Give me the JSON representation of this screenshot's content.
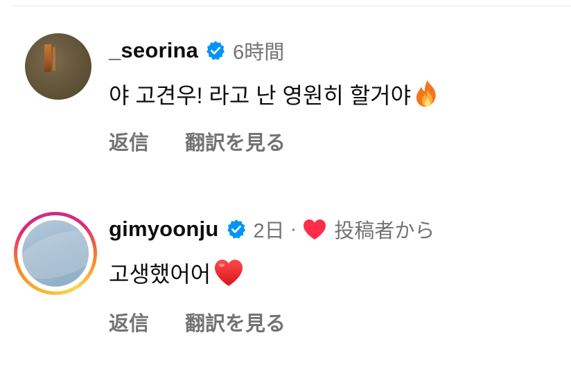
{
  "comments": [
    {
      "username": "_seorina",
      "verified": true,
      "timestamp": "6時間",
      "text": "야 고견우! 라고 난 영원히 할거야",
      "emoji": "fire-emoji",
      "actions": {
        "reply": "返信",
        "translate": "翻訳を見る"
      }
    },
    {
      "username": "gimyoonju",
      "verified": true,
      "timestamp": "2日",
      "separator": "·",
      "liked_by_author_label": "投稿者から",
      "text": "고생했어어",
      "emoji": "red-heart-emoji",
      "actions": {
        "reply": "返信",
        "translate": "翻訳を見る"
      }
    }
  ],
  "colors": {
    "verified_blue": "#0095f6",
    "meta_gray": "#737373",
    "heart_red": "#ff2d4a"
  }
}
